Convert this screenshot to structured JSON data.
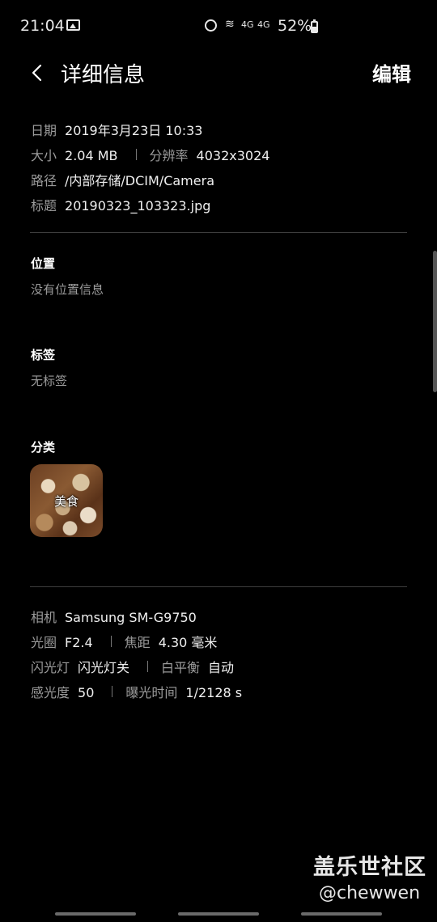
{
  "status_bar": {
    "time": "21:04",
    "signal1": "4G",
    "signal2": "4G",
    "battery_percent": "52%"
  },
  "header": {
    "title": "详细信息",
    "edit_label": "编辑"
  },
  "details": {
    "date_label": "日期",
    "date_value": "2019年3月23日 10:33",
    "size_label": "大小",
    "size_value": "2.04 MB",
    "resolution_label": "分辨率",
    "resolution_value": "4032x3024",
    "path_label": "路径",
    "path_value": "/内部存储/DCIM/Camera",
    "name_label": "标题",
    "name_value": "20190323_103323.jpg"
  },
  "location": {
    "title": "位置",
    "value": "没有位置信息"
  },
  "tags": {
    "title": "标签",
    "value": "无标签"
  },
  "category": {
    "title": "分类",
    "item_label": "美食"
  },
  "camera": {
    "camera_label": "相机",
    "camera_value": "Samsung SM-G9750",
    "aperture_label": "光圈",
    "aperture_value": "F2.4",
    "focal_label": "焦距",
    "focal_value": "4.30 毫米",
    "flash_label": "闪光灯",
    "flash_value": "闪光灯关",
    "wb_label": "白平衡",
    "wb_value": "自动",
    "iso_label": "感光度",
    "iso_value": "50",
    "exposure_label": "曝光时间",
    "exposure_value": "1/2128 s"
  },
  "watermark": {
    "line1": "盖乐世社区",
    "line2": "@chewwen"
  }
}
